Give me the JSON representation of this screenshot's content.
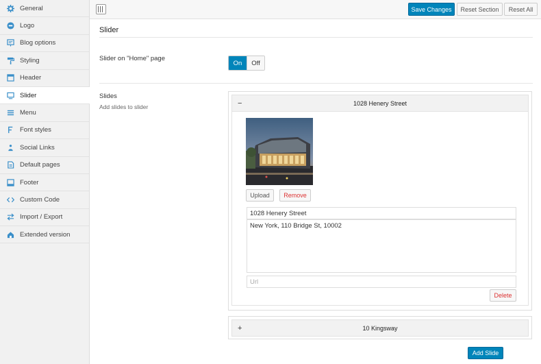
{
  "sidebar": {
    "items": [
      {
        "label": "General",
        "icon": "gear-icon"
      },
      {
        "label": "Logo",
        "icon": "logo-icon"
      },
      {
        "label": "Blog options",
        "icon": "blog-icon"
      },
      {
        "label": "Styling",
        "icon": "paint-roller-icon"
      },
      {
        "label": "Header",
        "icon": "header-icon"
      },
      {
        "label": "Slider",
        "icon": "slider-icon",
        "active": true
      },
      {
        "label": "Menu",
        "icon": "menu-icon"
      },
      {
        "label": "Font styles",
        "icon": "font-icon"
      },
      {
        "label": "Social Links",
        "icon": "social-icon"
      },
      {
        "label": "Default pages",
        "icon": "pages-icon"
      },
      {
        "label": "Footer",
        "icon": "footer-icon"
      },
      {
        "label": "Custom Code",
        "icon": "code-icon"
      },
      {
        "label": "Import / Export",
        "icon": "import-export-icon"
      },
      {
        "label": "Extended version",
        "icon": "home-icon"
      }
    ]
  },
  "toolbar": {
    "save_label": "Save Changes",
    "reset_section_label": "Reset Section",
    "reset_all_label": "Reset All"
  },
  "section": {
    "title": "Slider"
  },
  "home_slider": {
    "label": "Slider on \"Home\" page",
    "on_label": "On",
    "off_label": "Off",
    "selected": "On"
  },
  "slides": {
    "label": "Slides",
    "description": "Add slides to slider",
    "items": [
      {
        "title": "1028 Henery Street",
        "expanded_sign": "−",
        "upload_label": "Upload",
        "remove_label": "Remove",
        "title_value": "1028 Henery Street",
        "description_value": "New York, 110 Bridge St, 10002",
        "url_placeholder": "Url",
        "delete_label": "Delete"
      },
      {
        "title": "10 Kingsway",
        "collapsed_sign": "+"
      }
    ],
    "add_label": "Add Slide"
  },
  "colors": {
    "accent": "#0085ba",
    "danger": "#dc3232",
    "icon": "#3a8fc9"
  }
}
